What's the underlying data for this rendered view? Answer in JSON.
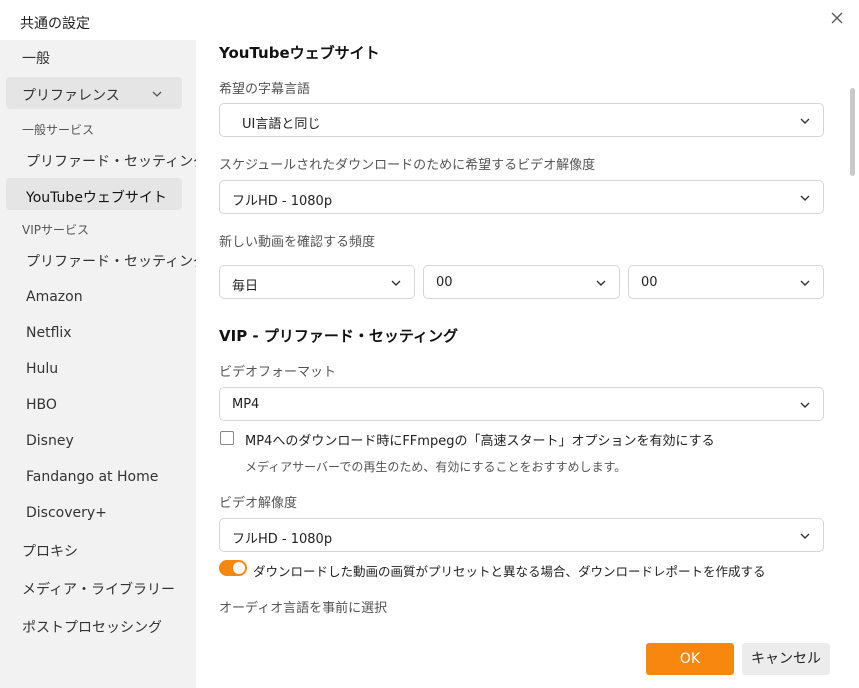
{
  "window": {
    "title": "共通の設定"
  },
  "colors": {
    "accent": "#f7870f",
    "sidebar_bg": "#f2f2f2",
    "selected_bg": "#e5e5e5",
    "cancel_bg": "#ececec"
  },
  "sidebar": {
    "general": "一般",
    "preferences": "プリファレンス",
    "general_services_header": "一般サービス",
    "pref_setting": "プリファード・セッティング",
    "youtube": "YouTubeウェブサイト",
    "vip_services_header": "VIPサービス",
    "vip_pref_setting": "プリファード・セッティング",
    "amazon": "Amazon",
    "netflix": "Netflix",
    "hulu": "Hulu",
    "hbo": "HBO",
    "disney": "Disney",
    "fandango": "Fandango at Home",
    "discovery": "Discovery+",
    "proxy": "プロキシ",
    "media_library": "メディア・ライブラリー",
    "post_processing": "ポストプロセッシング"
  },
  "youtube_section": {
    "title": "YouTubeウェブサイト",
    "subtitle_lang_label": "希望の字幕言語",
    "subtitle_lang_value": "UI言語と同じ",
    "scheduled_res_label": "スケジュールされたダウンロードのために希望するビデオ解像度",
    "scheduled_res_value": "フルHD - 1080p",
    "check_freq_label": "新しい動画を確認する頻度",
    "freq_value": "毎日",
    "hour_value": "00",
    "minute_value": "00"
  },
  "vip_section": {
    "title": "VIP - プリファード・セッティング",
    "format_label": "ビデオフォーマット",
    "format_value": "MP4",
    "faststart_label": "MP4へのダウンロード時にFFmpegの「高速スタート」オプションを有効にする",
    "faststart_checked": false,
    "faststart_hint": "メディアサーバーでの再生のため、有効にすることをおすすめします。",
    "res_label": "ビデオ解像度",
    "res_value": "フルHD - 1080p",
    "report_toggle_label": "ダウンロードした動画の画質がプリセットと異なる場合、ダウンロードレポートを作成する",
    "report_toggle_on": true,
    "audio_lang_label": "オーディオ言語を事前に選択"
  },
  "footer": {
    "ok": "OK",
    "cancel": "キャンセル"
  },
  "icons": {
    "close": "close-icon",
    "chevron": "chevron-down-icon"
  }
}
